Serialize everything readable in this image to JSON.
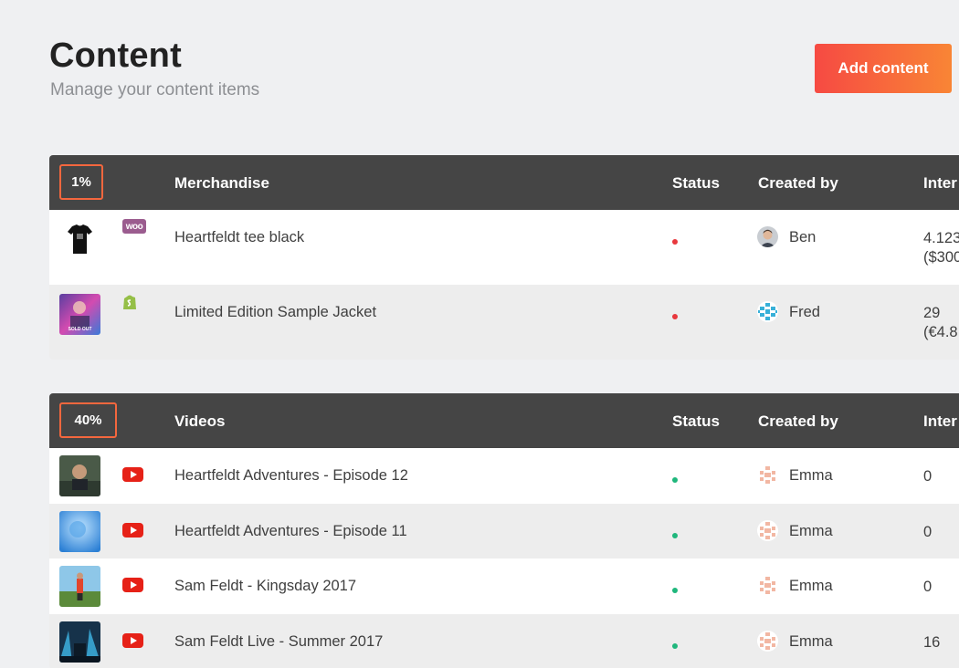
{
  "header": {
    "title": "Content",
    "subtitle": "Manage your content items",
    "add_button": "Add content"
  },
  "columns": {
    "status": "Status",
    "created_by": "Created by",
    "interactions": "Inter"
  },
  "colors": {
    "status_inactive": "#e8383d",
    "status_active": "#1fb77c",
    "accent_start": "#f64a43",
    "accent_end": "#f98535"
  },
  "merchandise": {
    "percent": "1%",
    "title": "Merchandise",
    "rows": [
      {
        "name": "Heartfeldt tee black",
        "source": "woo",
        "source_icon": "woocommerce-icon",
        "status": "inactive",
        "creator": "Ben",
        "interactions_line1": "4.123",
        "interactions_line2": "($300"
      },
      {
        "name": "Limited Edition Sample Jacket",
        "source": "shopify",
        "source_icon": "shopify-icon",
        "thumb_text": "SOLD OUT",
        "status": "inactive",
        "creator": "Fred",
        "interactions_line1": "29",
        "interactions_line2": "(€4.8"
      }
    ]
  },
  "videos": {
    "percent": "40%",
    "title": "Videos",
    "rows": [
      {
        "name": "Heartfeldt Adventures - Episode 12",
        "source_icon": "youtube-icon",
        "status": "active",
        "creator": "Emma",
        "interactions": "0"
      },
      {
        "name": "Heartfeldt Adventures - Episode 11",
        "source_icon": "youtube-icon",
        "status": "active",
        "creator": "Emma",
        "interactions": "0"
      },
      {
        "name": "Sam Feldt - Kingsday 2017",
        "source_icon": "youtube-icon",
        "status": "active",
        "creator": "Emma",
        "interactions": "0"
      },
      {
        "name": "Sam Feldt Live - Summer 2017",
        "source_icon": "youtube-icon",
        "status": "active",
        "creator": "Emma",
        "interactions": "16"
      }
    ]
  }
}
